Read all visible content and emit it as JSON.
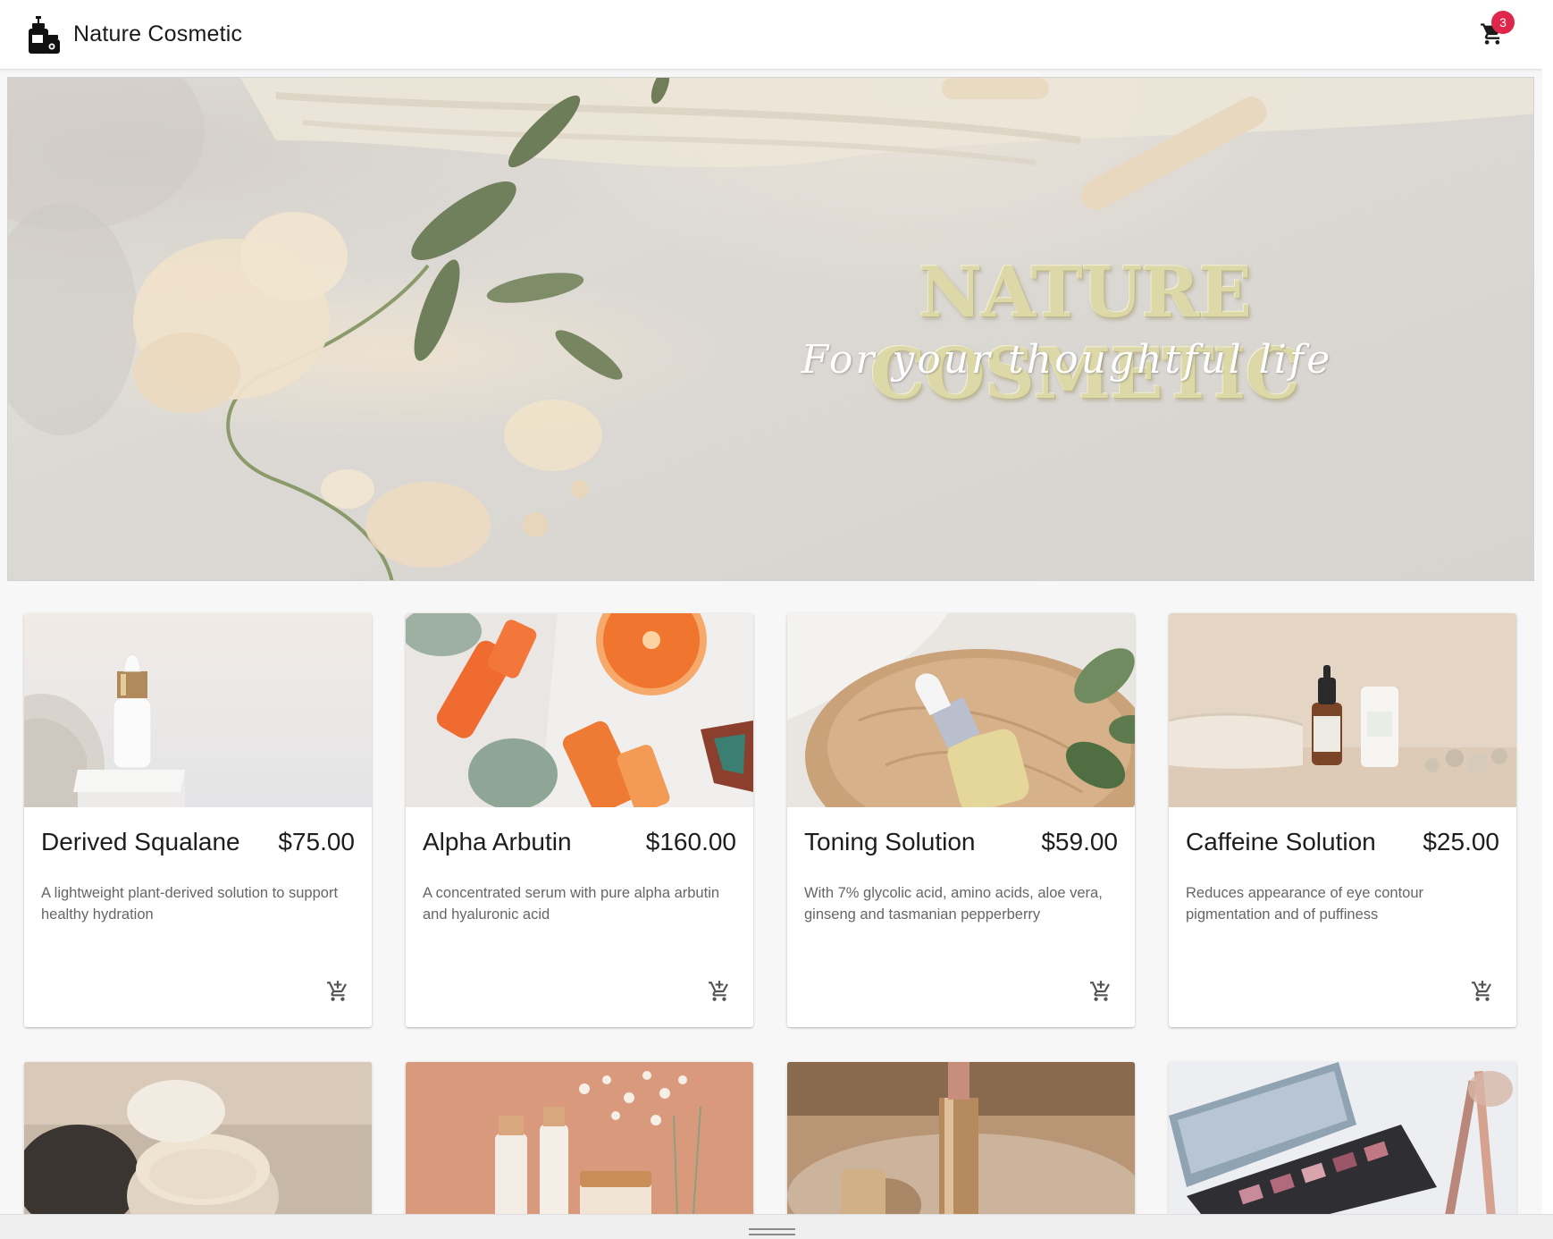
{
  "app": {
    "title": "Nature Cosmetic",
    "logo_icon": "cosmetics-bottles-icon",
    "cart_icon": "shopping-cart-icon",
    "cart_count": "3",
    "accent_color": "#e0264a"
  },
  "hero": {
    "title": "NATURE COSMETIC",
    "tagline": "For your thoughtful life"
  },
  "products": [
    {
      "name": "Derived Squalane",
      "price": "$75.00",
      "description": "A lightweight plant-derived solution to support healthy hydration",
      "action_icon": "add-shopping-cart-icon"
    },
    {
      "name": "Alpha Arbutin",
      "price": "$160.00",
      "description": "A concentrated serum with pure alpha arbutin and hyaluronic acid",
      "action_icon": "add-shopping-cart-icon"
    },
    {
      "name": "Toning Solution",
      "price": "$59.00",
      "description": "With 7% glycolic acid, amino acids, aloe vera, ginseng and tasmanian pepperberry",
      "action_icon": "add-shopping-cart-icon"
    },
    {
      "name": "Caffeine Solution",
      "price": "$25.00",
      "description": "Reduces appearance of eye contour pigmentation and of puffiness",
      "action_icon": "add-shopping-cart-icon"
    }
  ]
}
